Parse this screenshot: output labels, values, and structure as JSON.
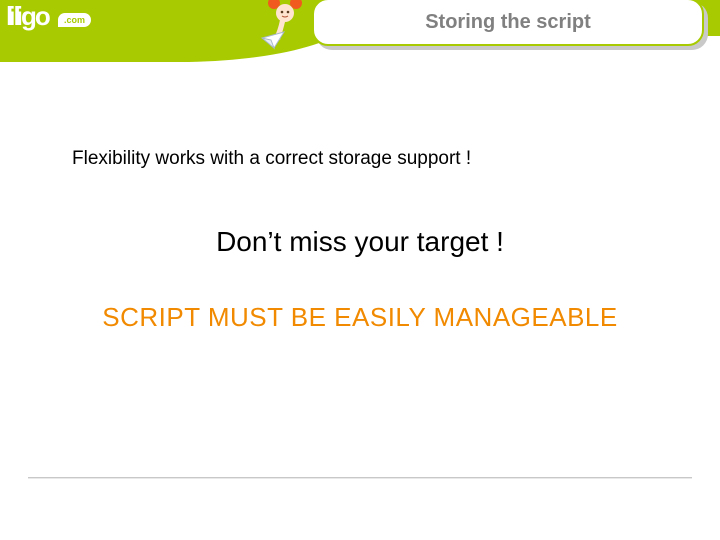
{
  "logo": {
    "brand": "liligo",
    "suffix": ".com"
  },
  "header": {
    "title": "Storing the script"
  },
  "body": {
    "line1": "Flexibility works with a correct storage support !",
    "line2": "Don’t miss your target !",
    "line3": "SCRIPT MUST BE EASILY MANAGEABLE"
  },
  "colors": {
    "accent_green": "#a7cb00",
    "accent_orange": "#f18a00",
    "title_gray": "#808080"
  }
}
